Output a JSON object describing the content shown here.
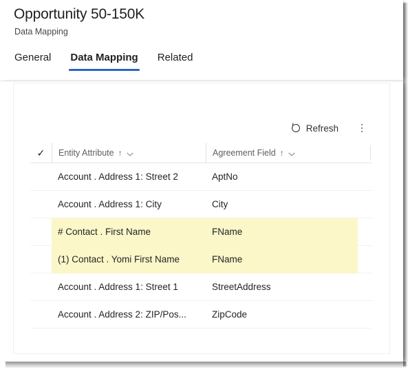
{
  "header": {
    "title": "Opportunity 50-150K",
    "subtitle": "Data Mapping"
  },
  "tabs": [
    {
      "label": "General",
      "active": false
    },
    {
      "label": "Data Mapping",
      "active": true
    },
    {
      "label": "Related",
      "active": false
    }
  ],
  "commandbar": {
    "refresh_label": "Refresh",
    "refresh_icon": "refresh-circular-arrow-icon",
    "overflow_icon": "more-vertical-icon"
  },
  "grid": {
    "select_all_icon": "checkmark-icon",
    "columns": [
      {
        "label": "Entity Attribute",
        "sort_icon": "sort-ascending-arrow",
        "menu_icon": "chevron-down-icon"
      },
      {
        "label": "Agreement Field",
        "sort_icon": "sort-ascending-arrow",
        "menu_icon": "chevron-down-icon"
      }
    ],
    "rows": [
      {
        "entity_attribute": "Account . Address 1: Street 2",
        "agreement_field": "AptNo",
        "highlighted": false
      },
      {
        "entity_attribute": "Account . Address 1: City",
        "agreement_field": "City",
        "highlighted": false
      },
      {
        "entity_attribute": "# Contact . First Name",
        "agreement_field": "FName",
        "highlighted": true
      },
      {
        "entity_attribute": "(1) Contact . Yomi First Name",
        "agreement_field": "FName",
        "highlighted": true
      },
      {
        "entity_attribute": "Account . Address 1: Street 1",
        "agreement_field": "StreetAddress",
        "highlighted": false
      },
      {
        "entity_attribute": "Account . Address 2: ZIP/Pos...",
        "agreement_field": "ZipCode",
        "highlighted": false
      }
    ]
  },
  "colors": {
    "accent": "#2b66c2",
    "highlight_row": "#fbf7c8",
    "text_primary": "#201f1e",
    "text_secondary": "#605e5c"
  }
}
